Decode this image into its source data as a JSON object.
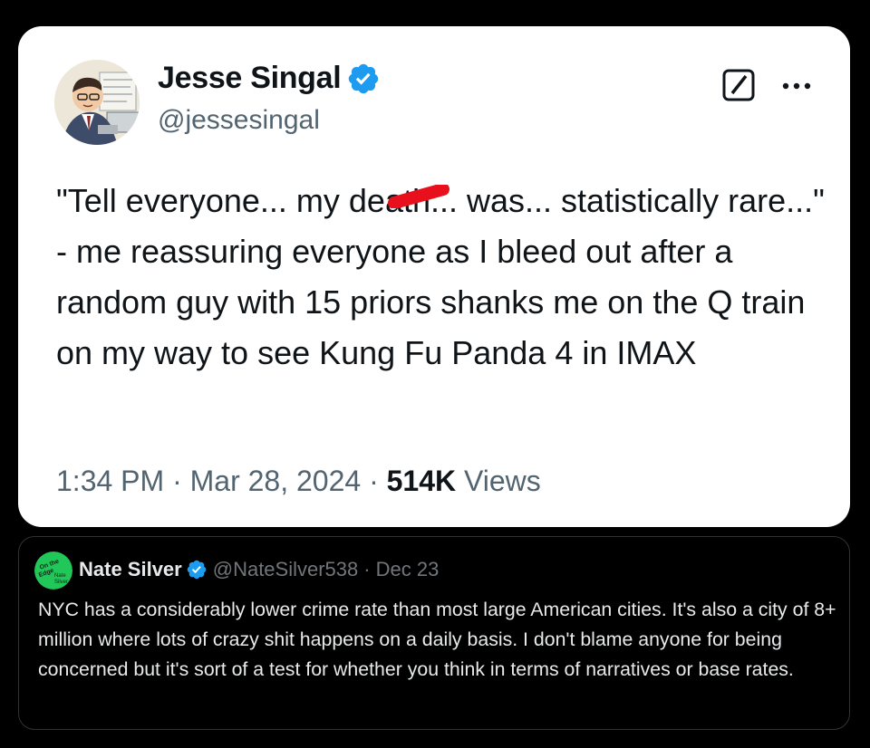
{
  "tweet": {
    "author": {
      "name": "Jesse Singal",
      "handle": "@jessesingal",
      "verified_icon": "verified-badge-icon"
    },
    "text_part1": "\"Tell everyone... my d",
    "text_redacted": "eath",
    "text_part2": "... was... statistically rare...\" - me reassuring everyone as I bleed out after a random guy with 15 priors shanks me on the Q train on my way to see Kung Fu Panda 4 in IMAX",
    "time": "1:34 PM",
    "separator": "·",
    "date": "Mar 28, 2024",
    "views_count": "514K",
    "views_label": "Views",
    "icons": {
      "grok": "grok-icon",
      "more": "more-icon"
    }
  },
  "quote": {
    "author": {
      "name": "Nate Silver",
      "handle": "@NateSilver538",
      "avatar_text": "On the Edge Nate Silver"
    },
    "separator": "·",
    "date": "Dec 23",
    "text": "NYC has a considerably lower crime rate than most large American cities. It's also a city of 8+ million where lots of crazy shit happens on a daily basis. I don't blame anyone for being concerned but it's sort of a test for whether you think in terms of narratives or base rates."
  },
  "colors": {
    "verified_blue": "#1d9bf0",
    "redaction_red": "#e8101c",
    "text_primary": "#0f1419",
    "text_secondary": "#536471",
    "quote_avatar_green": "#22c75a"
  }
}
